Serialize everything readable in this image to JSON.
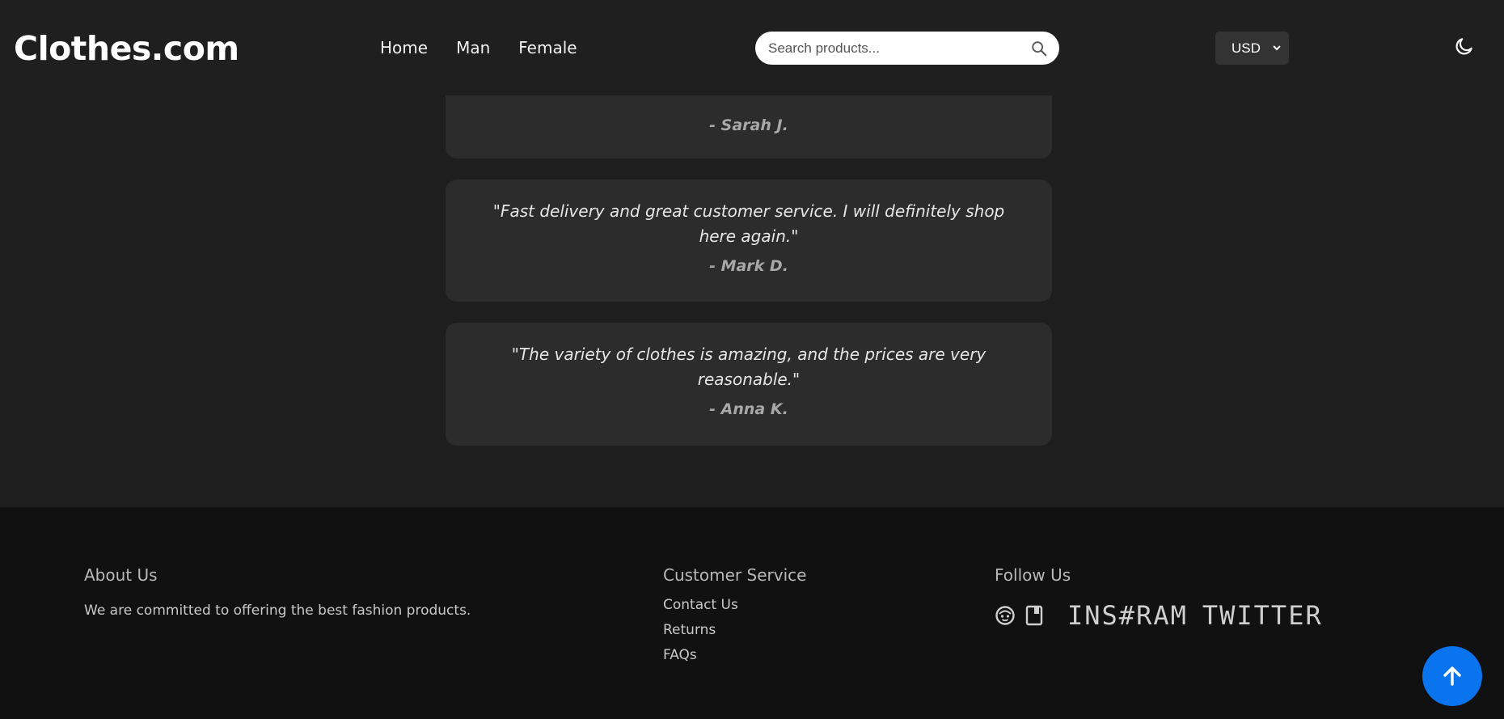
{
  "header": {
    "logo": "Clothes.com",
    "nav": [
      "Home",
      "Man",
      "Female"
    ],
    "search_placeholder": "Search products...",
    "currency": "USD"
  },
  "testimonials": [
    {
      "quote": "",
      "author": "- Sarah J."
    },
    {
      "quote": "\"Fast delivery and great customer service. I will definitely shop here again.\"",
      "author": "- Mark D."
    },
    {
      "quote": "\"The variety of clothes is amazing, and the prices are very reasonable.\"",
      "author": "- Anna K."
    }
  ],
  "footer": {
    "about": {
      "heading": "About Us",
      "text": "We are committed to offering the best fashion products."
    },
    "service": {
      "heading": "Customer Service",
      "links": [
        "Contact Us",
        "Returns",
        "FAQs"
      ]
    },
    "follow": {
      "heading": "Follow Us",
      "instagram": "INS#RAM",
      "twitter": "TWITTER"
    }
  },
  "colors": {
    "accent": "#0a74ee",
    "background": "#1e1e1e",
    "card": "#2c2c2c",
    "footer": "#111111"
  }
}
